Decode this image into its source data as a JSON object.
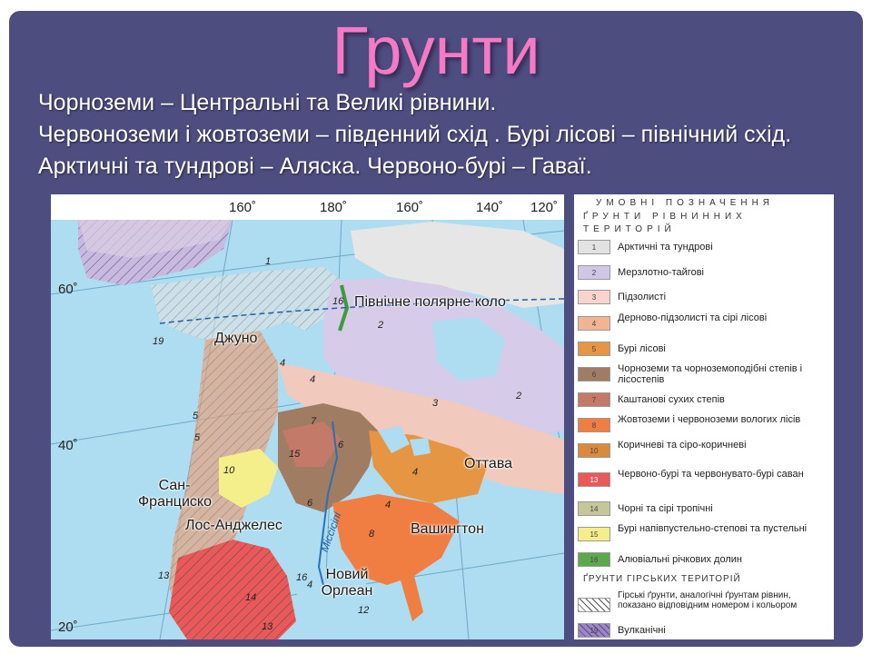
{
  "slide": {
    "title": "Грунти",
    "lines": [
      "Чорноземи – Центральні та Великі рівнини.",
      "Червоноземи і жовтоземи – південний схід . Бурі лісові – північний схід.",
      "Арктичні та тундрові – Аляска. Червоно-бурі – Гаваї."
    ]
  },
  "map": {
    "longitudes": [
      "160˚",
      "180˚",
      "160˚",
      "140˚",
      "120˚"
    ],
    "latitudes": [
      "60˚",
      "40˚",
      "20˚"
    ],
    "places": {
      "polar_circle": "Північне полярне коло",
      "juneau": "Джуно",
      "ottawa": "Оттава",
      "san_francisco": "Сан-Франциско",
      "los_angeles": "Лос-Анджелес",
      "washington": "Вашингтон",
      "mississippi": "Міссісіпі",
      "new_orleans": "Новий Орлеан"
    },
    "zone_numbers": [
      "1",
      "2",
      "16",
      "19",
      "4",
      "4",
      "5",
      "7",
      "15",
      "6",
      "3",
      "2",
      "10",
      "6",
      "8",
      "13",
      "4",
      "16",
      "13",
      "12",
      "14",
      "4",
      "5",
      "4"
    ]
  },
  "legend": {
    "heading1": "УМОВНІ ПОЗНАЧЕННЯ",
    "heading2": "ҐРУНТИ РІВНИННИХ ТЕРИТОРІЙ",
    "items": [
      {
        "num": "1",
        "label": "Арктичні та тундрові",
        "color": "#e2e2e2"
      },
      {
        "num": "2",
        "label": "Мерзлотно-тайгові",
        "color": "#d0c6e6"
      },
      {
        "num": "3",
        "label": "Підзолисті",
        "color": "#f7d4cc"
      },
      {
        "num": "4",
        "label": "Дерново-підзолисті та сірі лісові",
        "color": "#f2b593"
      },
      {
        "num": "5",
        "label": "Бурі лісові",
        "color": "#e69542"
      },
      {
        "num": "6",
        "label": "Чорноземи та чорноземоподібні степів і лісостепів",
        "color": "#9f7c64"
      },
      {
        "num": "7",
        "label": "Каштанові сухих степів",
        "color": "#c47a68"
      },
      {
        "num": "8",
        "label": "Жовтоземи і червоноземи вологих лісів",
        "color": "#f07e42"
      },
      {
        "num": "10",
        "label": "Коричневі та сіро-коричневі",
        "color": "#d98a3b"
      },
      {
        "num": "13",
        "label": "Червоно-бурі та червонувато-бурі саван",
        "color": "#e9595a"
      },
      {
        "num": "14",
        "label": "Чорні та сірі тропічні",
        "color": "#c5c79b"
      },
      {
        "num": "15",
        "label": "Бурі напівпустельно-степові та пустельні",
        "color": "#f4ef8a"
      },
      {
        "num": "16",
        "label": "Алювіальні річкових долин",
        "color": "#5ea84c"
      }
    ],
    "heading3": "ҐРУНТИ ГІРСЬКИХ ТЕРИТОРІЙ",
    "mountain_items": [
      {
        "label": "Гірські ґрунти, аналогічні ґрунтам рівнин, показано відповідним номером і кольором"
      },
      {
        "num": "19",
        "label": "Вулканічні",
        "color": "#9d86c6"
      }
    ]
  }
}
